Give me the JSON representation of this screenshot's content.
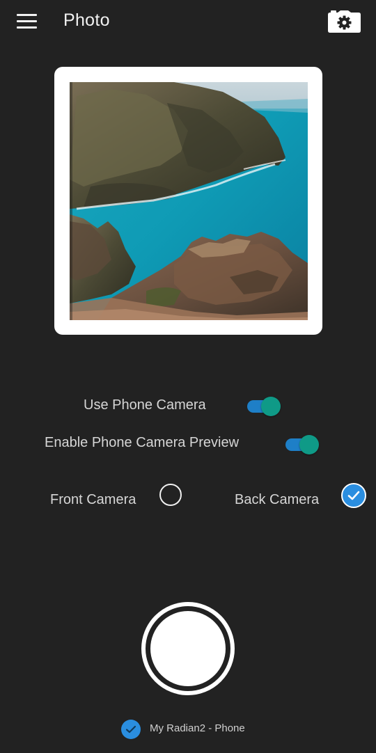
{
  "header": {
    "title": "Photo",
    "menu_icon": "hamburger-menu-icon",
    "settings_icon": "camera-settings-icon"
  },
  "preview": {
    "image": "coastal-cliffs-photo"
  },
  "options": {
    "use_phone_camera": {
      "label": "Use Phone Camera",
      "enabled": true
    },
    "enable_preview": {
      "label": "Enable Phone Camera Preview",
      "enabled": true
    }
  },
  "camera_select": {
    "front": {
      "label": "Front Camera",
      "selected": false
    },
    "back": {
      "label": "Back Camera",
      "selected": true
    }
  },
  "device": {
    "label": "My Radian2 - Phone",
    "checked": true
  },
  "colors": {
    "background": "#222222",
    "toggle_track": "#1e7fc7",
    "toggle_thumb": "#0f9a87",
    "check_blue": "#2a8ee0"
  }
}
